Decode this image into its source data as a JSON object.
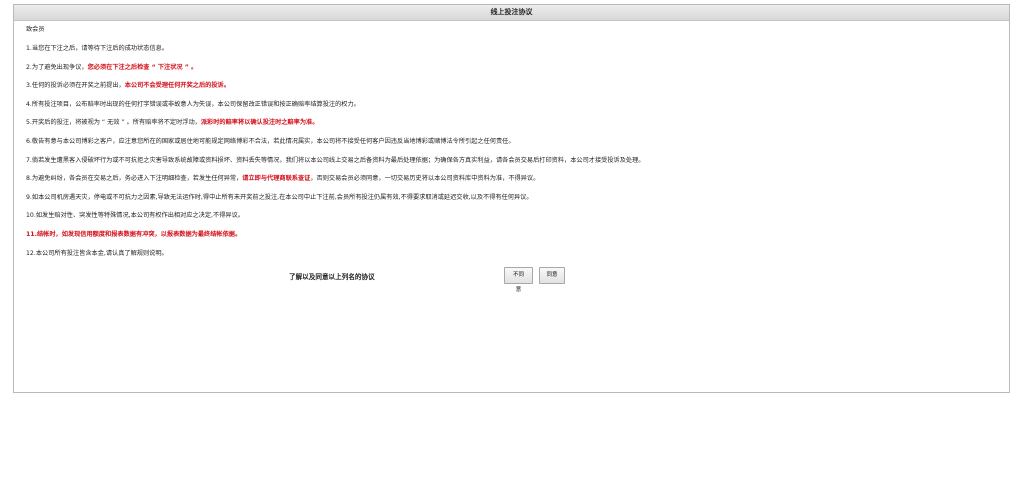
{
  "window": {
    "title": "线上投注协议"
  },
  "greeting": "致会员",
  "rules": [
    {
      "segments": [
        {
          "text": "1.当您在下注之后，请等待下注后的成功状态信息。",
          "red": false
        }
      ]
    },
    {
      "segments": [
        {
          "text": "2.为了避免出现争议，",
          "red": false
        },
        {
          "text": "您必须在下注之后检查 “ 下注状况 ” 。",
          "red": true
        }
      ]
    },
    {
      "segments": [
        {
          "text": "3.任何的投诉必须在开奖之前提出，",
          "red": false
        },
        {
          "text": "本公司不会受理任何开奖之后的投诉。",
          "red": true
        }
      ]
    },
    {
      "segments": [
        {
          "text": "4.所有投注项目，公布赔率时出现的任何打字错误或非故意人为失误，本公司保留改正错误和按正确赔率结算投注的权力。",
          "red": false
        }
      ]
    },
    {
      "segments": [
        {
          "text": "5.开奖后的投注，将被视为 “ 无效 ” 。所有赔率将不定时浮动，",
          "red": false
        },
        {
          "text": "派彩时的赔率将以确认投注时之赔率为准。",
          "red": true
        }
      ]
    },
    {
      "segments": [
        {
          "text": "6.敬告有意与本公司博彩之客户，应注意您所在的国家或居住地可能规定网络博彩不合法，若此情况属实，本公司将不接受任何客户因违反当地博彩或赌博法令所引起之任何责任。",
          "red": false
        }
      ]
    },
    {
      "segments": [
        {
          "text": "7.倘若发生遭黑客入侵破坏行为或不可抗拒之灾害导致系统故障或资料损坏、资料丢失等情况，我们将以本公司线上交易之后备资料为最后处理依据；为确保各方真实利益，请各会员交易后打印资料，本公司才接受投诉及处理。",
          "red": false
        }
      ]
    },
    {
      "segments": [
        {
          "text": "8.为避免纠纷，各会员在交易之后，务必进入下注明细检查，若发生任何异常，",
          "red": false
        },
        {
          "text": "请立即与代理商联系查证",
          "red": true
        },
        {
          "text": "，否则交易会员必须同意，一切交易历史将以本公司资料库中资料为准，不得异议。",
          "red": false
        }
      ]
    },
    {
      "segments": [
        {
          "text": "9.如本公司机房遇天灾，停电或不可抗力之因素,导致无法运作时,得中止所有未开奖前之投注,在本公司中止下注前,会员所有投注仍属有效,不得要求取消或延迟交收,以及不得有任何异议。",
          "red": false
        }
      ]
    },
    {
      "segments": [
        {
          "text": "10.如发生赔对性、突发性等特殊情况,本公司有权作出相对应之决定,不得异议。",
          "red": false
        }
      ]
    },
    {
      "segments": [
        {
          "text": "11.结帐时，如发现信用额度和报表数据有冲突，以报表数据为最终结帐依据。",
          "red": true
        }
      ]
    },
    {
      "segments": [
        {
          "text": "12.本公司所有投注皆含本金,请认真了解规则说明。",
          "red": false
        }
      ]
    }
  ],
  "agreement": {
    "label": "了解以及同意以上列名的协议",
    "disagree_label": "不同意",
    "agree_label": "同意"
  },
  "colors": {
    "highlight_red": "#d4101a",
    "titlebar_bg": "#dcdcdc"
  }
}
